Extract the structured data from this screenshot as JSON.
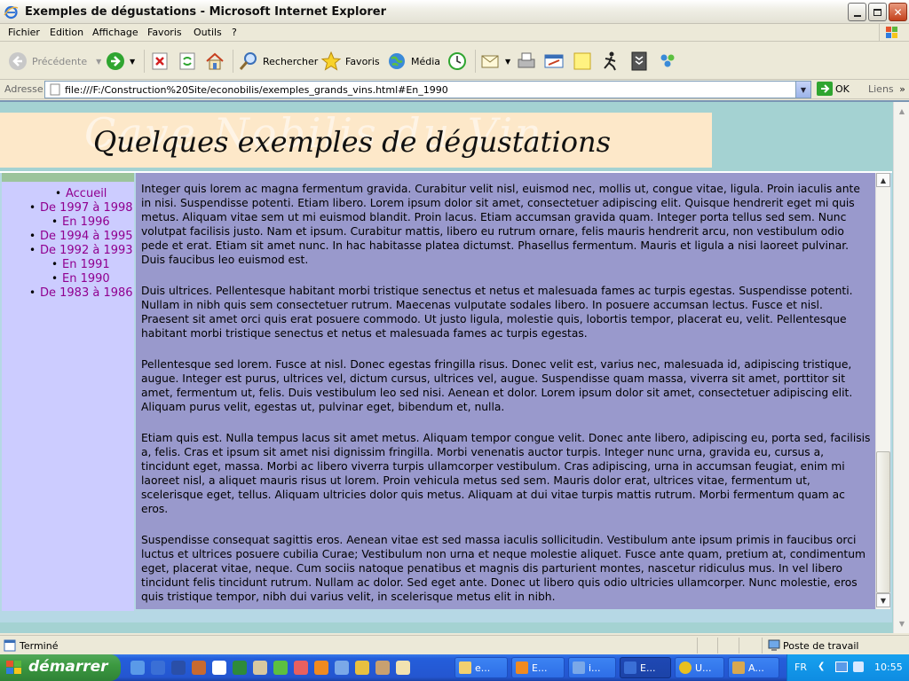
{
  "window": {
    "title": "Exemples de dégustations - Microsoft Internet Explorer",
    "controls": [
      "minimize",
      "maximize",
      "close"
    ]
  },
  "menu": {
    "items": [
      "Fichier",
      "Edition",
      "Affichage",
      "Favoris",
      "Outils",
      "?"
    ]
  },
  "toolbar": {
    "back_label": "Précédente",
    "search_label": "Rechercher",
    "favorites_label": "Favoris",
    "media_label": "Média"
  },
  "address": {
    "label": "Adresse",
    "url": "file:///F:/Construction%20Site/econobilis/exemples_grands_vins.html#En_1990",
    "go_label": "OK",
    "links_label": "Liens"
  },
  "page": {
    "headline": "Quelques exemples de dégustations",
    "watermark": "Cave Nobilis du Vin",
    "nav": [
      {
        "label": "Accueil",
        "level": 2
      },
      {
        "label": "De 1997 à 1998",
        "level": 1
      },
      {
        "label": "En 1996",
        "level": 2
      },
      {
        "label": "De 1994 à 1995",
        "level": 1
      },
      {
        "label": "De 1992 à 1993",
        "level": 1
      },
      {
        "label": "En 1991",
        "level": 2
      },
      {
        "label": "En 1990",
        "level": 2
      },
      {
        "label": "De 1983 à 1986",
        "level": 1
      }
    ],
    "paragraphs": [
      "Integer quis lorem ac magna fermentum gravida. Curabitur velit nisl, euismod nec, mollis ut, congue vitae, ligula. Proin iaculis ante in nisi. Suspendisse potenti. Etiam libero. Lorem ipsum dolor sit amet, consectetuer adipiscing elit. Quisque hendrerit eget mi quis metus. Aliquam vitae sem ut mi euismod blandit. Proin lacus. Etiam accumsan gravida quam. Integer porta tellus sed sem. Nunc volutpat facilisis justo. Nam et ipsum. Curabitur mattis, libero eu rutrum ornare, felis mauris hendrerit arcu, non vestibulum odio pede et erat. Etiam sit amet nunc. In hac habitasse platea dictumst. Phasellus fermentum. Mauris et ligula a nisi laoreet pulvinar. Duis faucibus leo euismod est.",
      "Duis ultrices. Pellentesque habitant morbi tristique senectus et netus et malesuada fames ac turpis egestas. Suspendisse potenti. Nullam in nibh quis sem consectetuer rutrum. Maecenas vulputate sodales libero. In posuere accumsan lectus. Fusce et nisl. Praesent sit amet orci quis erat posuere commodo. Ut justo ligula, molestie quis, lobortis tempor, placerat eu, velit. Pellentesque habitant morbi tristique senectus et netus et malesuada fames ac turpis egestas.",
      "Pellentesque sed lorem. Fusce at nisl. Donec egestas fringilla risus. Donec velit est, varius nec, malesuada id, adipiscing tristique, augue. Integer est purus, ultrices vel, dictum cursus, ultrices vel, augue. Suspendisse quam massa, viverra sit amet, porttitor sit amet, fermentum ut, felis. Duis vestibulum leo sed nisi. Aenean et dolor. Lorem ipsum dolor sit amet, consectetuer adipiscing elit. Aliquam purus velit, egestas ut, pulvinar eget, bibendum et, nulla.",
      "Etiam quis est. Nulla tempus lacus sit amet metus. Aliquam tempor congue velit. Donec ante libero, adipiscing eu, porta sed, facilisis a, felis. Cras et ipsum sit amet nisi dignissim fringilla. Morbi venenatis auctor turpis. Integer nunc urna, gravida eu, cursus a, tincidunt eget, massa. Morbi ac libero viverra turpis ullamcorper vestibulum. Cras adipiscing, urna in accumsan feugiat, enim mi laoreet nisl, a aliquet mauris risus ut lorem. Proin vehicula metus sed sem. Mauris dolor erat, ultrices vitae, fermentum ut, scelerisque eget, tellus. Aliquam ultricies dolor quis metus. Aliquam at dui vitae turpis mattis rutrum. Morbi fermentum quam ac eros.",
      "Suspendisse consequat sagittis eros. Aenean vitae est sed massa iaculis sollicitudin. Vestibulum ante ipsum primis in faucibus orci luctus et ultrices posuere cubilia Curae; Vestibulum non urna et neque molestie aliquet. Fusce ante quam, pretium at, condimentum eget, placerat vitae, neque. Cum sociis natoque penatibus et magnis dis parturient montes, nascetur ridiculus mus. In vel libero tincidunt felis tincidunt rutrum. Nullam ac dolor. Sed eget ante. Donec ut libero quis odio ultricies ullamcorper. Nunc molestie, eros quis tristique tempor, nibh dui varius velit, in scelerisque metus elit in nibh."
    ],
    "content_scroll_position": 1.0
  },
  "status": {
    "text": "Terminé",
    "zone": "Poste de travail"
  },
  "taskbar": {
    "start_label": "démarrer",
    "tasks": [
      "e...",
      "E...",
      "i...",
      "E...",
      "U...",
      "A..."
    ],
    "active_task": 3,
    "lang": "FR",
    "clock": "10:55"
  },
  "colors": {
    "page_bg": "#A4D2D2",
    "banner_bg": "#FDE8C9",
    "nav_bg": "#CCCCFF",
    "nav_link": "#900090",
    "content_bg": "#9999CC"
  }
}
